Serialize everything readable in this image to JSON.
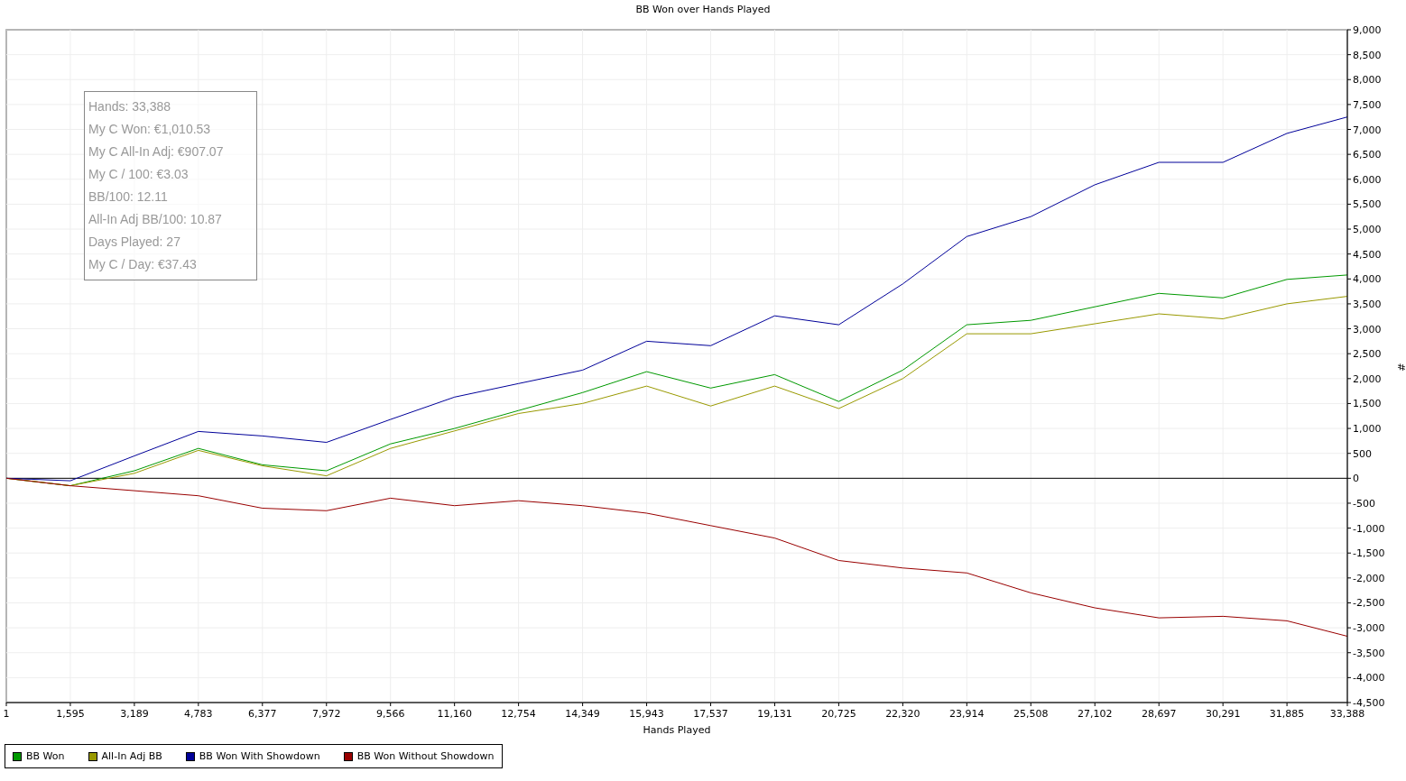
{
  "chart_data": {
    "type": "line",
    "title": "BB Won over Hands Played",
    "xlabel": "Hands Played",
    "ylabel": "#",
    "x": [
      1,
      1595,
      3189,
      4783,
      6377,
      7972,
      9566,
      11160,
      12754,
      14349,
      15943,
      17537,
      19131,
      20725,
      22320,
      23914,
      25508,
      27102,
      28697,
      30291,
      31885,
      33388
    ],
    "series": [
      {
        "name": "BB Won",
        "color": "#009900",
        "values": [
          0,
          -150,
          150,
          600,
          270,
          150,
          690,
          1000,
          1360,
          1720,
          2140,
          1810,
          2080,
          1540,
          2170,
          3080,
          3170,
          3440,
          3710,
          3620,
          3990,
          4080
        ]
      },
      {
        "name": "All-In Adj BB",
        "color": "#999900",
        "values": [
          0,
          -150,
          100,
          560,
          250,
          50,
          600,
          950,
          1300,
          1500,
          1850,
          1450,
          1850,
          1400,
          2000,
          2900,
          2900,
          3100,
          3300,
          3200,
          3500,
          3650
        ]
      },
      {
        "name": "BB Won With Showdown",
        "color": "#000099",
        "values": [
          0,
          -50,
          450,
          940,
          850,
          720,
          1180,
          1630,
          1900,
          2170,
          2750,
          2660,
          3260,
          3080,
          3900,
          4850,
          5250,
          5890,
          6340,
          6340,
          6920,
          7250
        ]
      },
      {
        "name": "BB Won Without Showdown",
        "color": "#990000",
        "values": [
          0,
          -150,
          -250,
          -350,
          -600,
          -650,
          -400,
          -550,
          -450,
          -550,
          -700,
          -950,
          -1200,
          -1650,
          -1800,
          -1900,
          -2300,
          -2600,
          -2800,
          -2770,
          -2860,
          -3170
        ]
      }
    ],
    "xlim": [
      1,
      33388
    ],
    "ylim": [
      -4500,
      9000
    ],
    "xticks": [
      1,
      {
        "value": 1595,
        "label": "1,595"
      },
      {
        "value": 3189,
        "label": "3,189"
      },
      {
        "value": 4783,
        "label": "4,783"
      },
      {
        "value": 6377,
        "label": "6,377"
      },
      {
        "value": 7972,
        "label": "7,972"
      },
      {
        "value": 9566,
        "label": "9,566"
      },
      {
        "value": 11160,
        "label": "11,160"
      },
      {
        "value": 12754,
        "label": "12,754"
      },
      {
        "value": 14349,
        "label": "14,349"
      },
      {
        "value": 15943,
        "label": "15,943"
      },
      {
        "value": 17537,
        "label": "17,537"
      },
      {
        "value": 19131,
        "label": "19,131"
      },
      {
        "value": 20725,
        "label": "20,725"
      },
      {
        "value": 22320,
        "label": "22,320"
      },
      {
        "value": 23914,
        "label": "23,914"
      },
      {
        "value": 25508,
        "label": "25,508"
      },
      {
        "value": 27102,
        "label": "27,102"
      },
      {
        "value": 28697,
        "label": "28,697"
      },
      {
        "value": 30291,
        "label": "30,291"
      },
      {
        "value": 31885,
        "label": "31,885"
      },
      {
        "value": 33388,
        "label": "33,388"
      }
    ],
    "yticks": [
      {
        "value": -4500,
        "label": "-4,500"
      },
      {
        "value": -4000,
        "label": "-4,000"
      },
      {
        "value": -3500,
        "label": "-3,500"
      },
      {
        "value": -3000,
        "label": "-3,000"
      },
      {
        "value": -2500,
        "label": "-2,500"
      },
      {
        "value": -2000,
        "label": "-2,000"
      },
      {
        "value": -1500,
        "label": "-1,500"
      },
      {
        "value": -1000,
        "label": "-1,000"
      },
      -500,
      0,
      500,
      {
        "value": 1000,
        "label": "1,000"
      },
      {
        "value": 1500,
        "label": "1,500"
      },
      {
        "value": 2000,
        "label": "2,000"
      },
      {
        "value": 2500,
        "label": "2,500"
      },
      {
        "value": 3000,
        "label": "3,000"
      },
      {
        "value": 3500,
        "label": "3,500"
      },
      {
        "value": 4000,
        "label": "4,000"
      },
      {
        "value": 4500,
        "label": "4,500"
      },
      {
        "value": 5000,
        "label": "5,000"
      },
      {
        "value": 5500,
        "label": "5,500"
      },
      {
        "value": 6000,
        "label": "6,000"
      },
      {
        "value": 6500,
        "label": "6,500"
      },
      {
        "value": 7000,
        "label": "7,000"
      },
      {
        "value": 7500,
        "label": "7,500"
      },
      {
        "value": 8000,
        "label": "8,000"
      },
      {
        "value": 8500,
        "label": "8,500"
      },
      {
        "value": 9000,
        "label": "9,000"
      }
    ],
    "grid": true
  },
  "stats": [
    "Hands: 33,388",
    "My C Won: €1,010.53",
    "My C All-In Adj: €907.07",
    "My C / 100: €3.03",
    "BB/100: 12.11",
    "All-In Adj BB/100: 10.87",
    "Days Played: 27",
    "My C / Day: €37.43"
  ]
}
